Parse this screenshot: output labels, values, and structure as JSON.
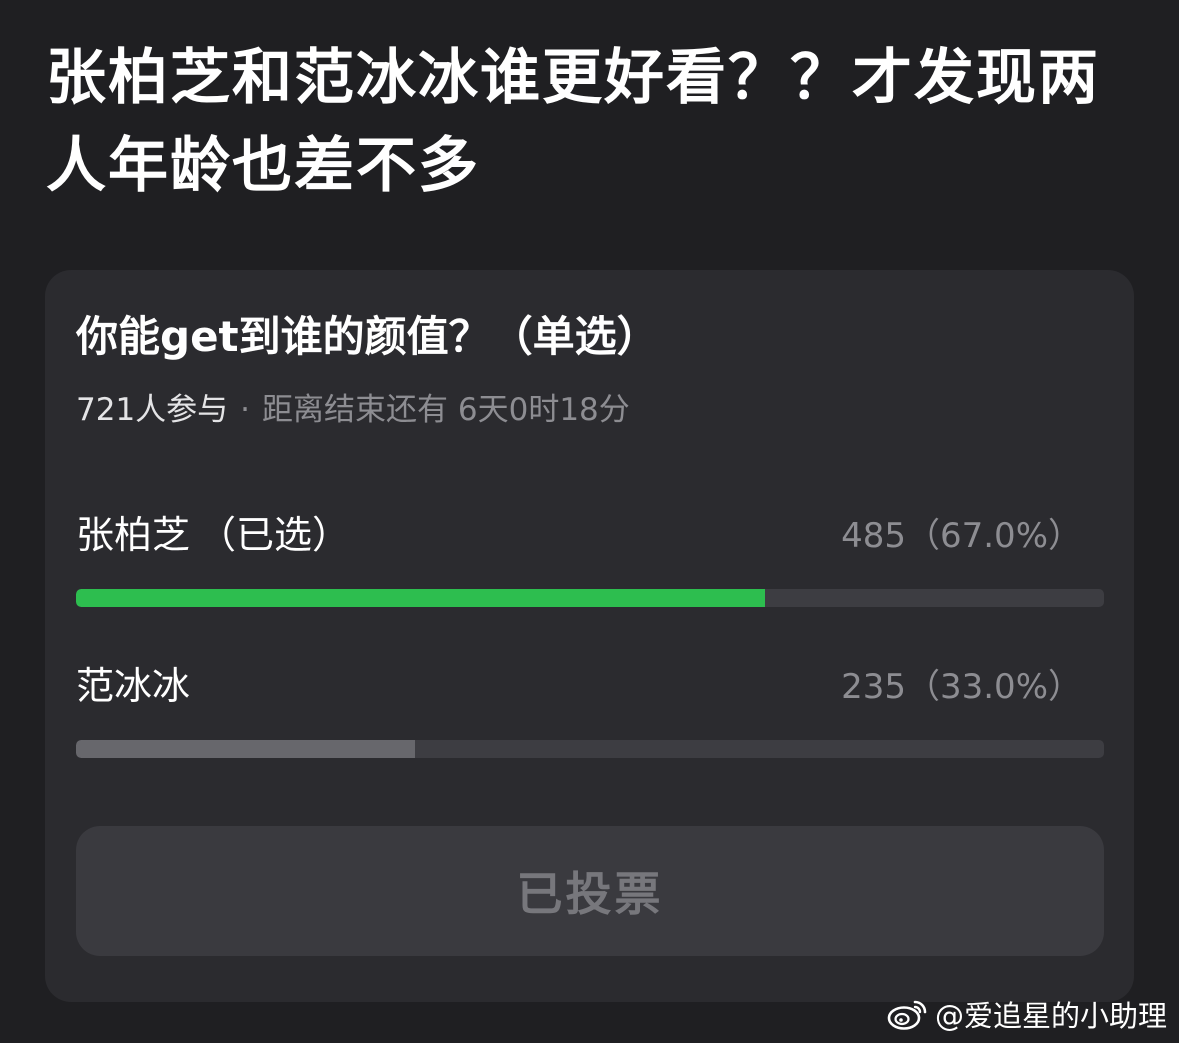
{
  "post": {
    "title": "张柏芝和范冰冰谁更好看？？才发现两人年龄也差不多"
  },
  "poll": {
    "question": "你能get到谁的颜值？（单选）",
    "participants": "721人参与",
    "separator": "·",
    "deadline": "距离结束还有 6天0时18分",
    "options": [
      {
        "label": "张柏芝",
        "selected_tag": "（已选）",
        "result": "485（67.0%）",
        "votes": 485,
        "percent": 67.0,
        "bar_color": "#2dbe4f"
      },
      {
        "label": "范冰冰",
        "result": "235（33.0%）",
        "votes": 235,
        "percent": 33.0,
        "bar_color": "#67676c"
      }
    ],
    "button_label": "已投票"
  },
  "watermark": {
    "icon": "weibo-logo-icon",
    "text": "@爱追星的小助理"
  },
  "colors": {
    "background": "#1f1f22",
    "card": "#2b2b2f",
    "selected_bar": "#2dbe4f",
    "unselected_bar": "#67676c",
    "track": "#3d3d42"
  }
}
